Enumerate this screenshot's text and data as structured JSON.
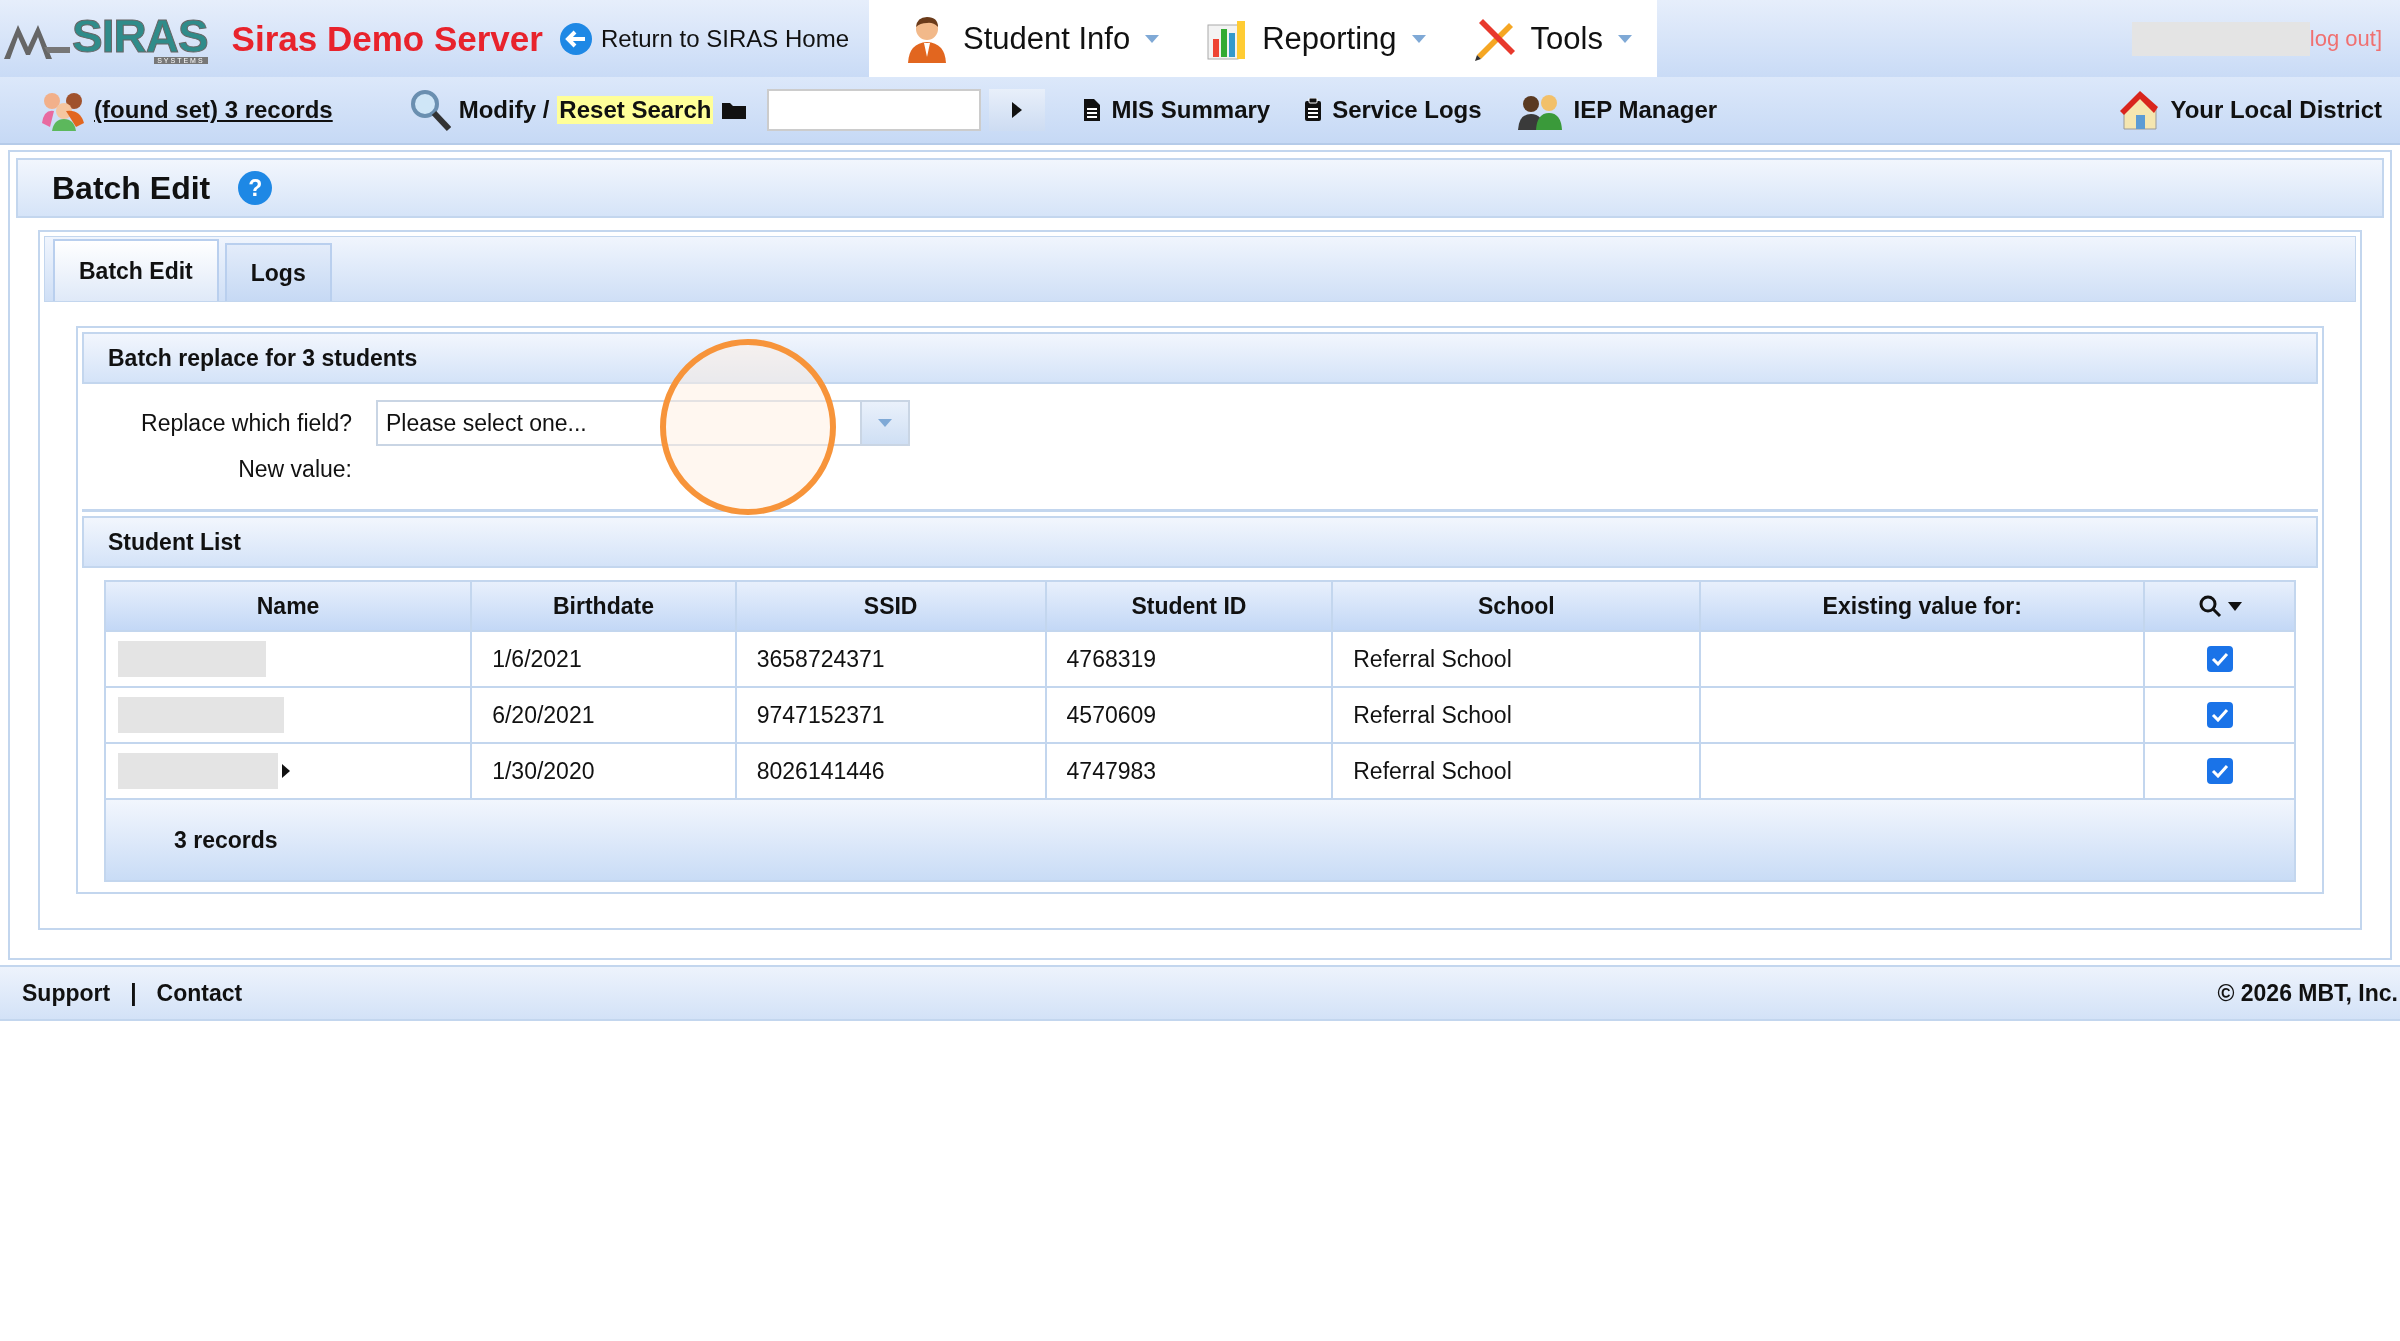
{
  "header": {
    "logo": {
      "text": "SIRAS",
      "subtext": "SYSTEMS"
    },
    "server_name": "Siras Demo Server",
    "home_link": "Return to SIRAS Home",
    "menus": [
      {
        "label": "Student Info"
      },
      {
        "label": "Reporting"
      },
      {
        "label": "Tools"
      }
    ],
    "logout": "log out]"
  },
  "toolbar": {
    "found_set": "(found set) 3 records",
    "modify": "Modify /",
    "reset_search": "Reset Search",
    "links": [
      {
        "label": "MIS Summary"
      },
      {
        "label": "Service Logs"
      },
      {
        "label": "IEP Manager"
      }
    ],
    "district": "Your Local District"
  },
  "page": {
    "title": "Batch Edit",
    "help": "?",
    "tabs": [
      {
        "label": "Batch Edit",
        "selected": true
      },
      {
        "label": "Logs",
        "selected": false
      }
    ],
    "batch": {
      "title": "Batch replace for 3 students",
      "fields": [
        {
          "kind": "select",
          "label": "Replace which field?",
          "placeholder": "Please select one..."
        },
        {
          "kind": "empty",
          "label": "New value:"
        }
      ]
    },
    "student_list": {
      "title": "Student List",
      "columns": [
        "Name",
        "Birthdate",
        "SSID",
        "Student ID",
        "School",
        "Existing value for:"
      ],
      "rows": [
        {
          "has_arrow": false,
          "birthdate": "1/6/2021",
          "ssid": "3658724371",
          "student_id": "4768319",
          "school": "Referral School",
          "checked": true
        },
        {
          "has_arrow": false,
          "birthdate": "6/20/2021",
          "ssid": "9747152371",
          "student_id": "4570609",
          "school": "Referral School",
          "checked": true
        },
        {
          "has_arrow": true,
          "birthdate": "1/30/2020",
          "ssid": "8026141446",
          "student_id": "4747983",
          "school": "Referral School",
          "checked": true
        }
      ],
      "footer": "3 records"
    }
  },
  "footer": {
    "links": [
      {
        "label": "Support"
      },
      {
        "label": "Contact"
      }
    ],
    "separator": "|",
    "copyright": "© 2026 MBT, Inc."
  }
}
